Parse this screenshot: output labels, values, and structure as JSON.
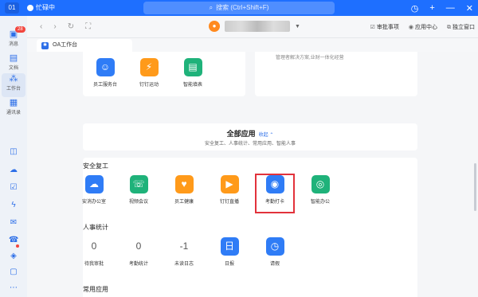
{
  "titlebar": {
    "avatar": "01",
    "status": "忙碌中",
    "search_placeholder": "搜索 (Ctrl+Shift+F)",
    "icons": [
      "history-icon",
      "add-icon",
      "minimize-icon",
      "close-icon"
    ]
  },
  "leftnav": {
    "items": [
      {
        "label": "消息",
        "icon": "message-icon",
        "badge": "28"
      },
      {
        "label": "文档",
        "icon": "document-icon"
      },
      {
        "label": "工作台",
        "icon": "workbench-icon"
      },
      {
        "label": "通讯录",
        "icon": "contacts-icon"
      }
    ]
  },
  "toolbar": {
    "todo": "审批事项",
    "app_center": "应用中心",
    "standalone": "独立窗口"
  },
  "tab": {
    "label": "OA工作台"
  },
  "top_apps": [
    {
      "name": "员工服务台",
      "color": "#2f7cf6",
      "glyph": "☺"
    },
    {
      "name": "钉钉运动",
      "color": "#ff9a1a",
      "glyph": "⚡"
    },
    {
      "name": "智能填表",
      "color": "#1fb27a",
      "glyph": "▤"
    }
  ],
  "top_right_text": "管理者解决方案,业财一体化经营",
  "all_apps": {
    "title": "全部应用",
    "collapse": "收起",
    "subtitle": "安全复工、人事统计、常用应用、智能人事"
  },
  "safe_return": {
    "title": "安全复工",
    "apps": [
      {
        "name": "安消办公室",
        "color": "#2f7cf6",
        "glyph": "☁"
      },
      {
        "name": "视频会议",
        "color": "#1fb27a",
        "glyph": "☏"
      },
      {
        "name": "员工健康",
        "color": "#ff9a1a",
        "glyph": "♥"
      },
      {
        "name": "钉钉直播",
        "color": "#ff9a1a",
        "glyph": "▶"
      },
      {
        "name": "考勤打卡",
        "color": "#2f7cf6",
        "glyph": "◉"
      },
      {
        "name": "智能办公",
        "color": "#1fb27a",
        "glyph": "◎"
      }
    ]
  },
  "hr_stats": {
    "title": "人事统计",
    "items": [
      {
        "value": "0",
        "name": "待我审批"
      },
      {
        "value": "0",
        "name": "考勤统计"
      },
      {
        "value": "-1",
        "name": "未读日志"
      }
    ],
    "apps": [
      {
        "name": "日报",
        "color": "#2f7cf6",
        "glyph": "日"
      },
      {
        "name": "请假",
        "color": "#2f7cf6",
        "glyph": "◷"
      }
    ]
  },
  "common_apps": {
    "title": "常用应用"
  }
}
